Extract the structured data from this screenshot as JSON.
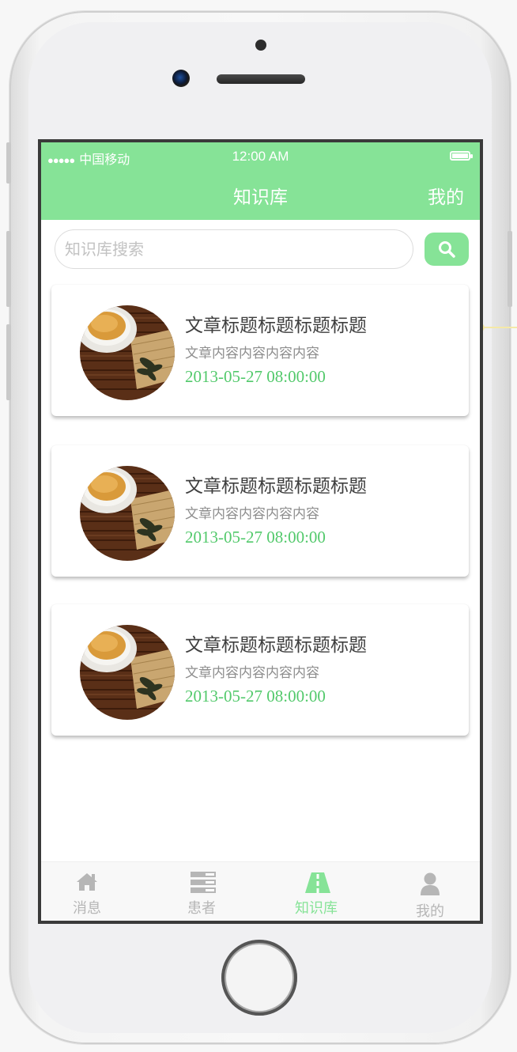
{
  "status_bar": {
    "signal": "●●●●●",
    "carrier": "中国移动",
    "time": "12:00 AM",
    "battery_icon": "battery-full-icon"
  },
  "nav": {
    "title": "知识库",
    "right_label": "我的"
  },
  "search": {
    "placeholder": "知识库搜索",
    "value": "",
    "button_icon": "search-icon"
  },
  "articles": [
    {
      "title": "文章标题标题标题标题",
      "summary": "文章内容内容内容内容",
      "date": "2013-05-27 08:00:00",
      "thumbnail": "tea-cup-image"
    },
    {
      "title": "文章标题标题标题标题",
      "summary": "文章内容内容内容内容",
      "date": "2013-05-27 08:00:00",
      "thumbnail": "tea-cup-image"
    },
    {
      "title": "文章标题标题标题标题",
      "summary": "文章内容内容内容内容",
      "date": "2013-05-27 08:00:00",
      "thumbnail": "tea-cup-image"
    }
  ],
  "tabs": [
    {
      "label": "消息",
      "icon": "home-icon",
      "active": false
    },
    {
      "label": "患者",
      "icon": "list-icon",
      "active": false
    },
    {
      "label": "知识库",
      "icon": "road-icon",
      "active": true
    },
    {
      "label": "我的",
      "icon": "user-icon",
      "active": false
    }
  ],
  "colors": {
    "accent": "#86e397",
    "date": "#52c96b",
    "title": "#3f3f3f",
    "summary": "#8e8e8e",
    "tab_inactive": "#b6b6b6"
  }
}
